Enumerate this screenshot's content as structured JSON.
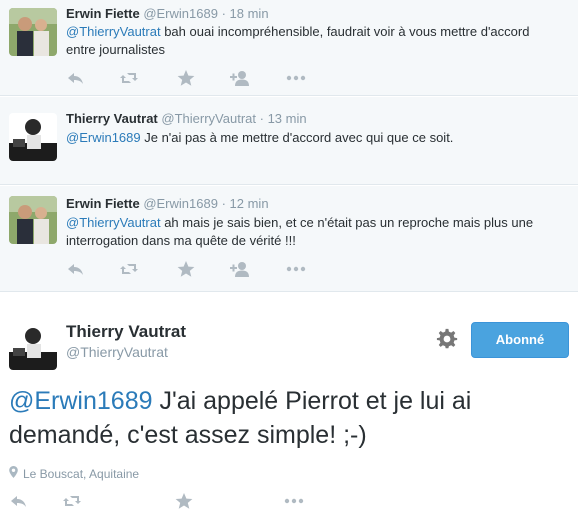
{
  "tweets": [
    {
      "name": "Erwin Fiette",
      "handle": "@Erwin1689",
      "time": "18 min",
      "mention": "@ThierryVautrat",
      "text": " bah ouai incompréhensible, faudrait voir à vous mettre d'accord entre journalistes"
    },
    {
      "name": "Thierry Vautrat",
      "handle": "@ThierryVautrat",
      "time": "13 min",
      "mention": "@Erwin1689",
      "text": " Je n'ai pas à me mettre d'accord avec qui que ce soit."
    },
    {
      "name": "Erwin Fiette",
      "handle": "@Erwin1689",
      "time": "12 min",
      "mention": "@ThierryVautrat",
      "text": " ah mais je sais bien, et ce n'était pas un reproche mais plus une interrogation dans ma quête de vérité !!!"
    }
  ],
  "separator": "·",
  "main": {
    "name": "Thierry Vautrat",
    "handle": "@ThierryVautrat",
    "follow_label": "Abonné",
    "mention": "@Erwin1689",
    "text": " J'ai appelé Pierrot et je lui ai demandé, c'est assez simple! ;-)",
    "location": "Le Bouscat, Aquitaine"
  },
  "colors": {
    "accent": "#2b7bb9",
    "follow_button": "#4aa3df",
    "muted": "#8899a6",
    "reply_bg": "#f5f8fa"
  },
  "icons": [
    "reply-icon",
    "retweet-icon",
    "favorite-icon",
    "follow-icon",
    "more-icon",
    "gear-icon",
    "location-pin-icon"
  ]
}
